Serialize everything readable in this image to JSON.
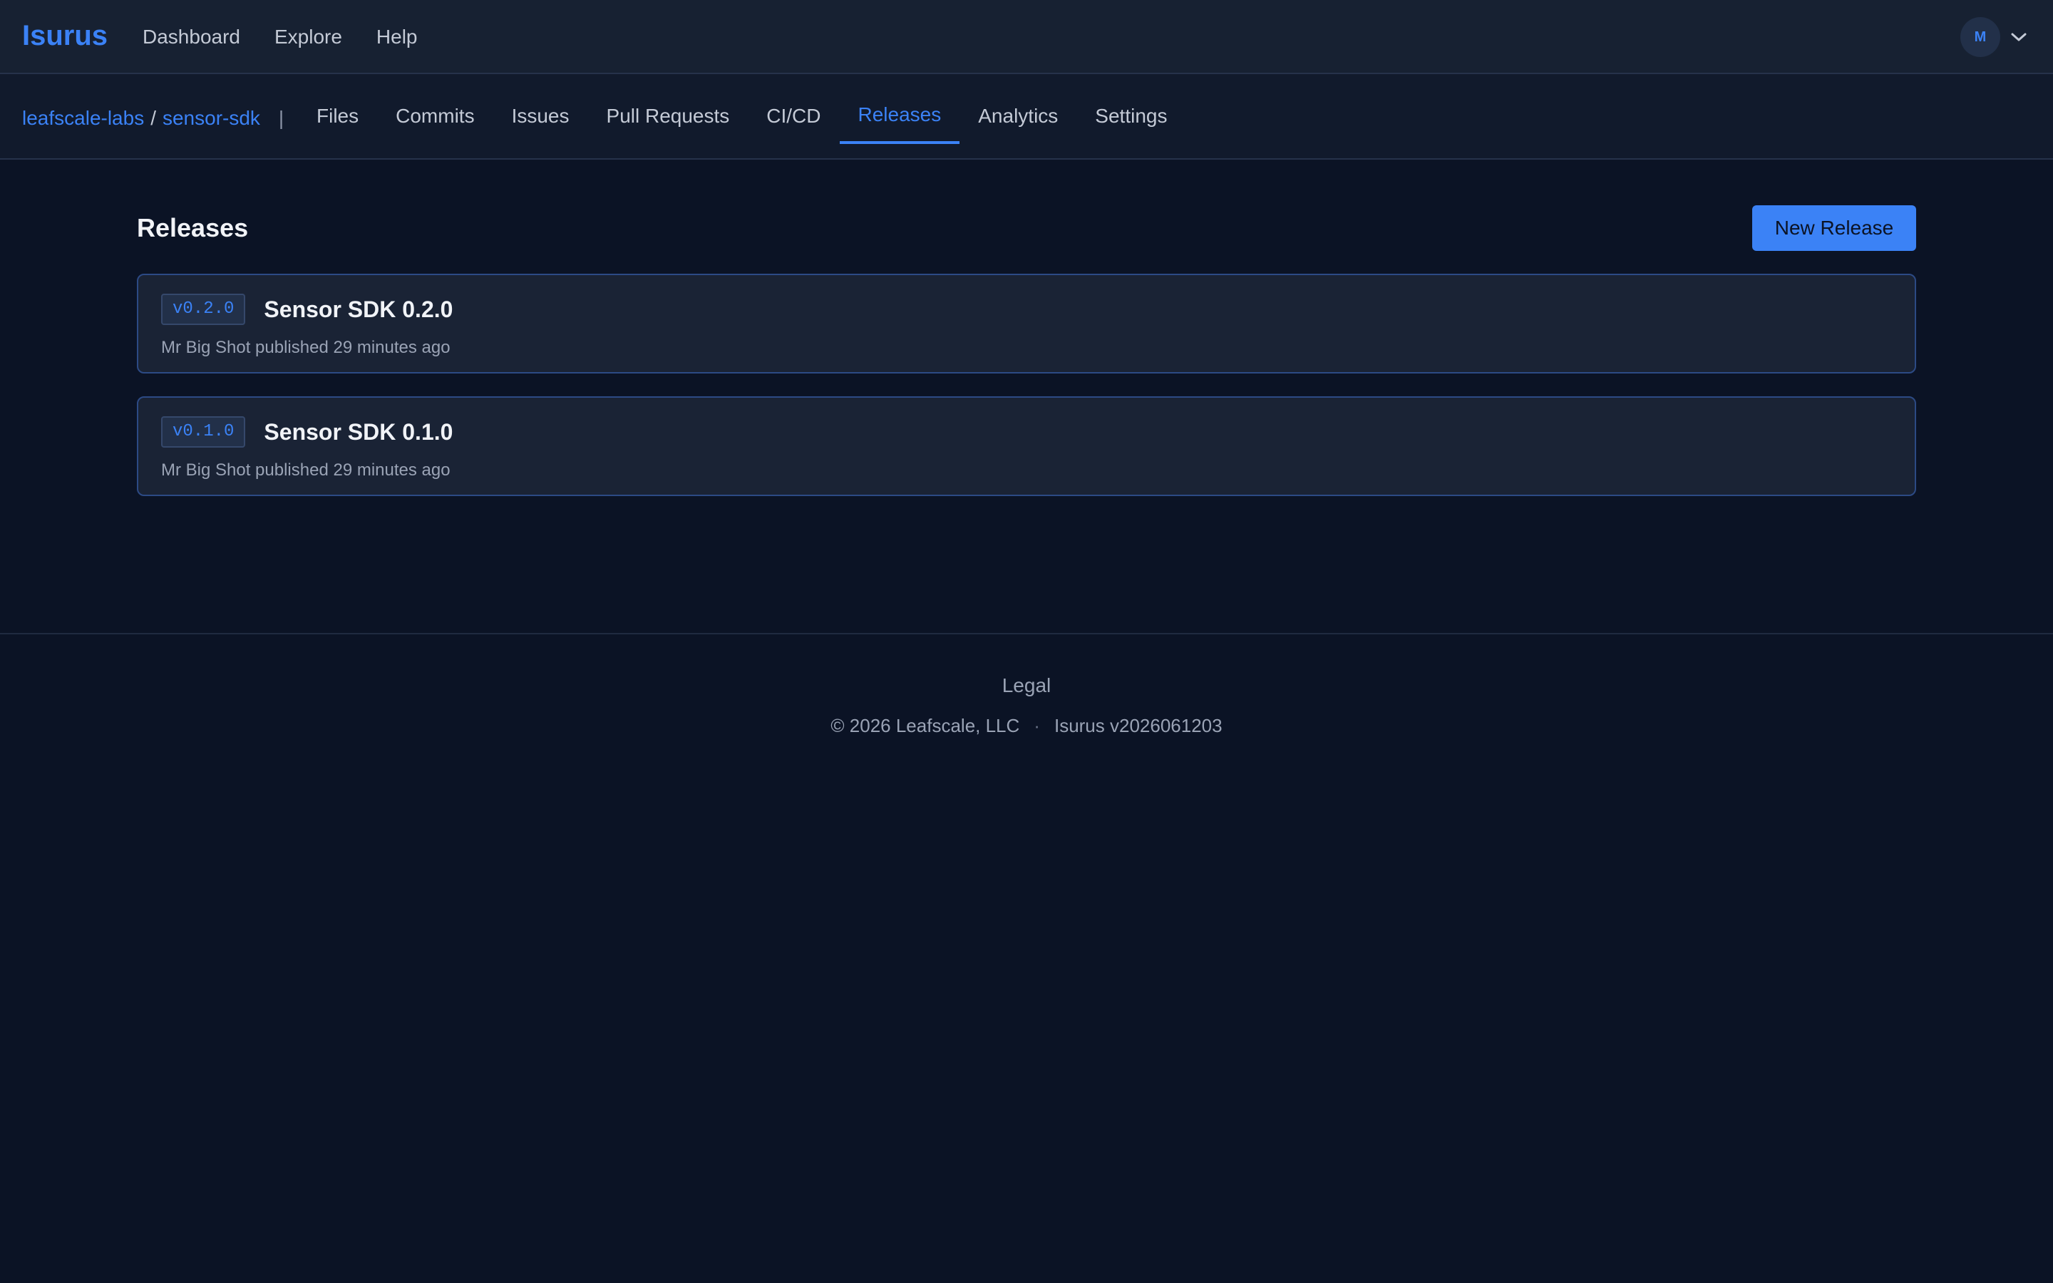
{
  "topbar": {
    "brand": "Isurus",
    "nav": [
      "Dashboard",
      "Explore",
      "Help"
    ],
    "user": {
      "initial": "M",
      "avatar_icon": "avatar-icon",
      "dropdown_icon": "chevron-down-icon"
    }
  },
  "repo": {
    "owner": "leafscale-labs",
    "separator": "/",
    "name": "sensor-sdk",
    "divider": "|",
    "tabs": [
      {
        "label": "Files"
      },
      {
        "label": "Commits"
      },
      {
        "label": "Issues"
      },
      {
        "label": "Pull Requests"
      },
      {
        "label": "CI/CD"
      },
      {
        "label": "Releases",
        "active": true
      },
      {
        "label": "Analytics"
      },
      {
        "label": "Settings"
      }
    ]
  },
  "page": {
    "title": "Releases",
    "new_release_label": "New Release"
  },
  "releases": [
    {
      "tag": "v0.2.0",
      "title": "Sensor SDK 0.2.0",
      "meta": "Mr Big Shot published 29 minutes ago"
    },
    {
      "tag": "v0.1.0",
      "title": "Sensor SDK 0.1.0",
      "meta": "Mr Big Shot published 29 minutes ago"
    }
  ],
  "footer": {
    "legal": "Legal",
    "copyright": "© 2026 Leafscale, LLC",
    "dot": "·",
    "version": "Isurus v2026061203"
  },
  "colors": {
    "accent": "#3b82f6",
    "background": "#0b1325",
    "card_border": "#2c4a85"
  }
}
